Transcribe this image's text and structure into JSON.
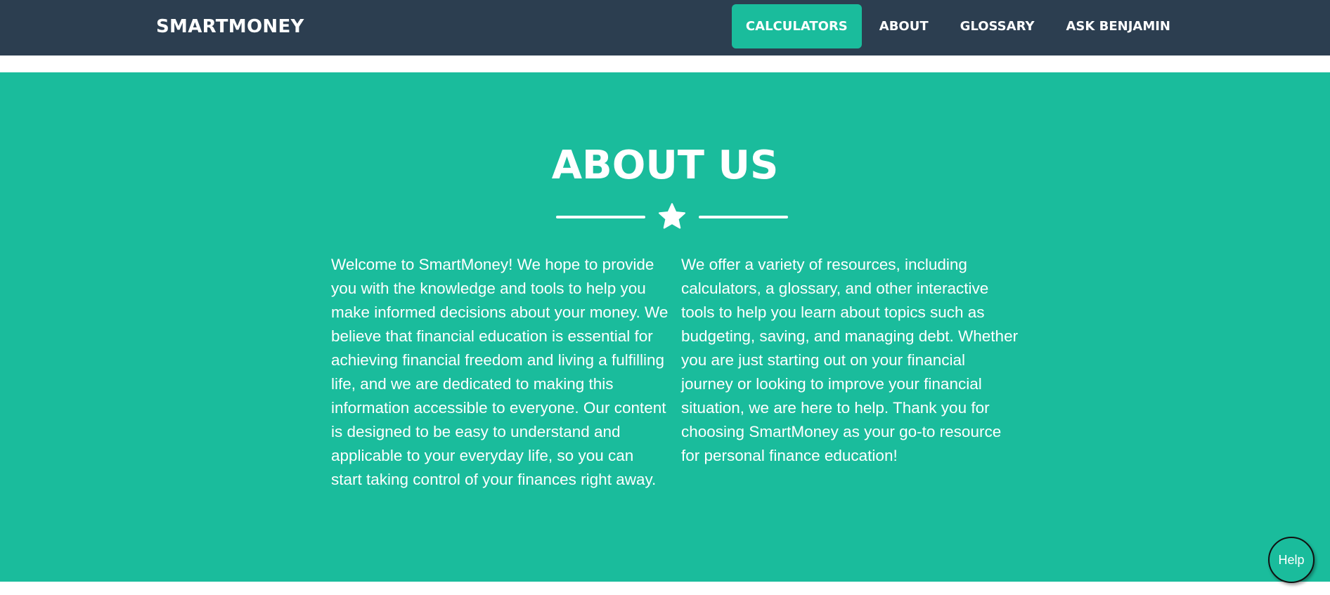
{
  "navbar": {
    "brand": "SMARTMONEY",
    "links": [
      {
        "label": "CALCULATORS",
        "active": true
      },
      {
        "label": "ABOUT",
        "active": false
      },
      {
        "label": "GLOSSARY",
        "active": false
      },
      {
        "label": "ASK BENJAMIN",
        "active": false
      }
    ],
    "background_color": "#2c3e50",
    "active_color": "#1abc9c"
  },
  "about": {
    "title": "ABOUT US",
    "divider_icon": "star-icon",
    "paragraph_left": "Welcome to SmartMoney! We hope to provide you with the knowledge and tools to help you make informed decisions about your money. We believe that financial education is essential for achieving financial freedom and living a fulfilling life, and we are dedicated to making this information accessible to everyone. Our content is designed to be easy to understand and applicable to your everyday life, so you can start taking control of your finances right away.",
    "paragraph_right": "We offer a variety of resources, including calculators, a glossary, and other interactive tools to help you learn about topics such as budgeting, saving, and managing debt. Whether you are just starting out on your financial journey or looking to improve your financial situation, we are here to help. Thank you for choosing SmartMoney as your go-to resource for personal finance education!",
    "background_color": "#1abc9c"
  },
  "help": {
    "label": "Help"
  }
}
